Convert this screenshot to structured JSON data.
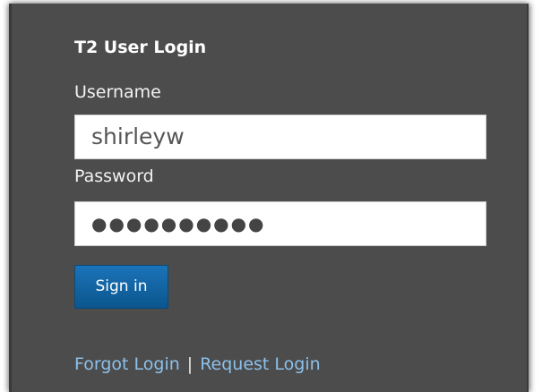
{
  "login": {
    "title": "T2 User Login",
    "username_label": "Username",
    "username_value": "shirleyw",
    "password_label": "Password",
    "password_masked": "●●●●●●●●●●",
    "signin_label": "Sign in",
    "forgot_link": "Forgot Login",
    "separator": "|",
    "request_link": "Request Login"
  },
  "colors": {
    "panel_background": "#4c4c4c",
    "button_blue": "#0b5c98",
    "link_blue": "#8cc0ea"
  }
}
